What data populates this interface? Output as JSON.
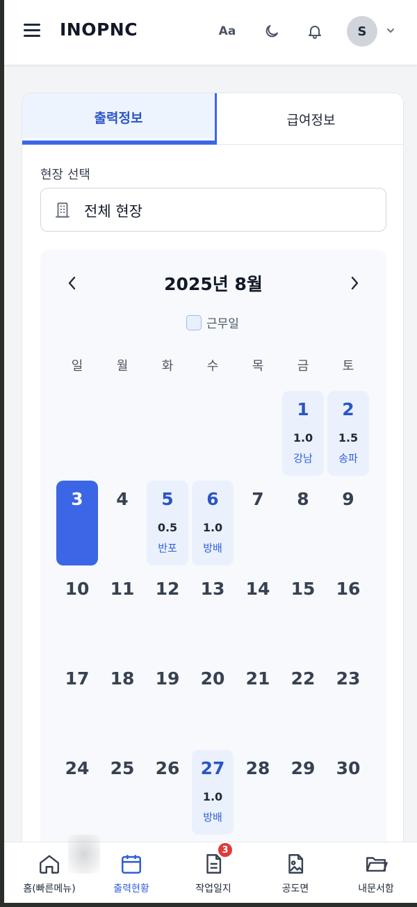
{
  "header": {
    "logo": "INOPNC",
    "font_button": "Aa",
    "avatar_initial": "S"
  },
  "tabs": [
    {
      "label": "출력정보",
      "active": true
    },
    {
      "label": "급여정보",
      "active": false
    }
  ],
  "site_select": {
    "label": "현장 선택",
    "value": "전체 현장"
  },
  "calendar": {
    "month_title": "2025년 8월",
    "legend": "근무일",
    "weekdays": [
      "일",
      "월",
      "화",
      "수",
      "목",
      "금",
      "토"
    ],
    "today": 3,
    "days": [
      {
        "day": "1",
        "hours": "1.0",
        "site": "강남"
      },
      {
        "day": "2",
        "hours": "1.5",
        "site": "송파"
      },
      {
        "day": "3"
      },
      {
        "day": "4"
      },
      {
        "day": "5",
        "hours": "0.5",
        "site": "반포"
      },
      {
        "day": "6",
        "hours": "1.0",
        "site": "방배"
      },
      {
        "day": "7"
      },
      {
        "day": "8"
      },
      {
        "day": "9"
      },
      {
        "day": "10"
      },
      {
        "day": "11"
      },
      {
        "day": "12"
      },
      {
        "day": "13"
      },
      {
        "day": "14"
      },
      {
        "day": "15"
      },
      {
        "day": "16"
      },
      {
        "day": "17"
      },
      {
        "day": "18"
      },
      {
        "day": "19"
      },
      {
        "day": "20"
      },
      {
        "day": "21"
      },
      {
        "day": "22"
      },
      {
        "day": "23"
      },
      {
        "day": "24"
      },
      {
        "day": "25"
      },
      {
        "day": "26"
      },
      {
        "day": "27",
        "hours": "1.0",
        "site": "방배"
      },
      {
        "day": "28"
      },
      {
        "day": "29"
      },
      {
        "day": "30"
      }
    ]
  },
  "bottom_nav": [
    {
      "label": "홈(빠른메뉴)",
      "icon": "home-icon"
    },
    {
      "label": "출력현황",
      "icon": "calendar-icon",
      "active": true
    },
    {
      "label": "작업일지",
      "icon": "document-icon",
      "badge": "3"
    },
    {
      "label": "공도면",
      "icon": "image-file-icon"
    },
    {
      "label": "내문서함",
      "icon": "folder-icon"
    }
  ],
  "colors": {
    "accent": "#3b66e6",
    "work_day_bg": "#eaf1fd",
    "badge": "#e03a3a"
  }
}
